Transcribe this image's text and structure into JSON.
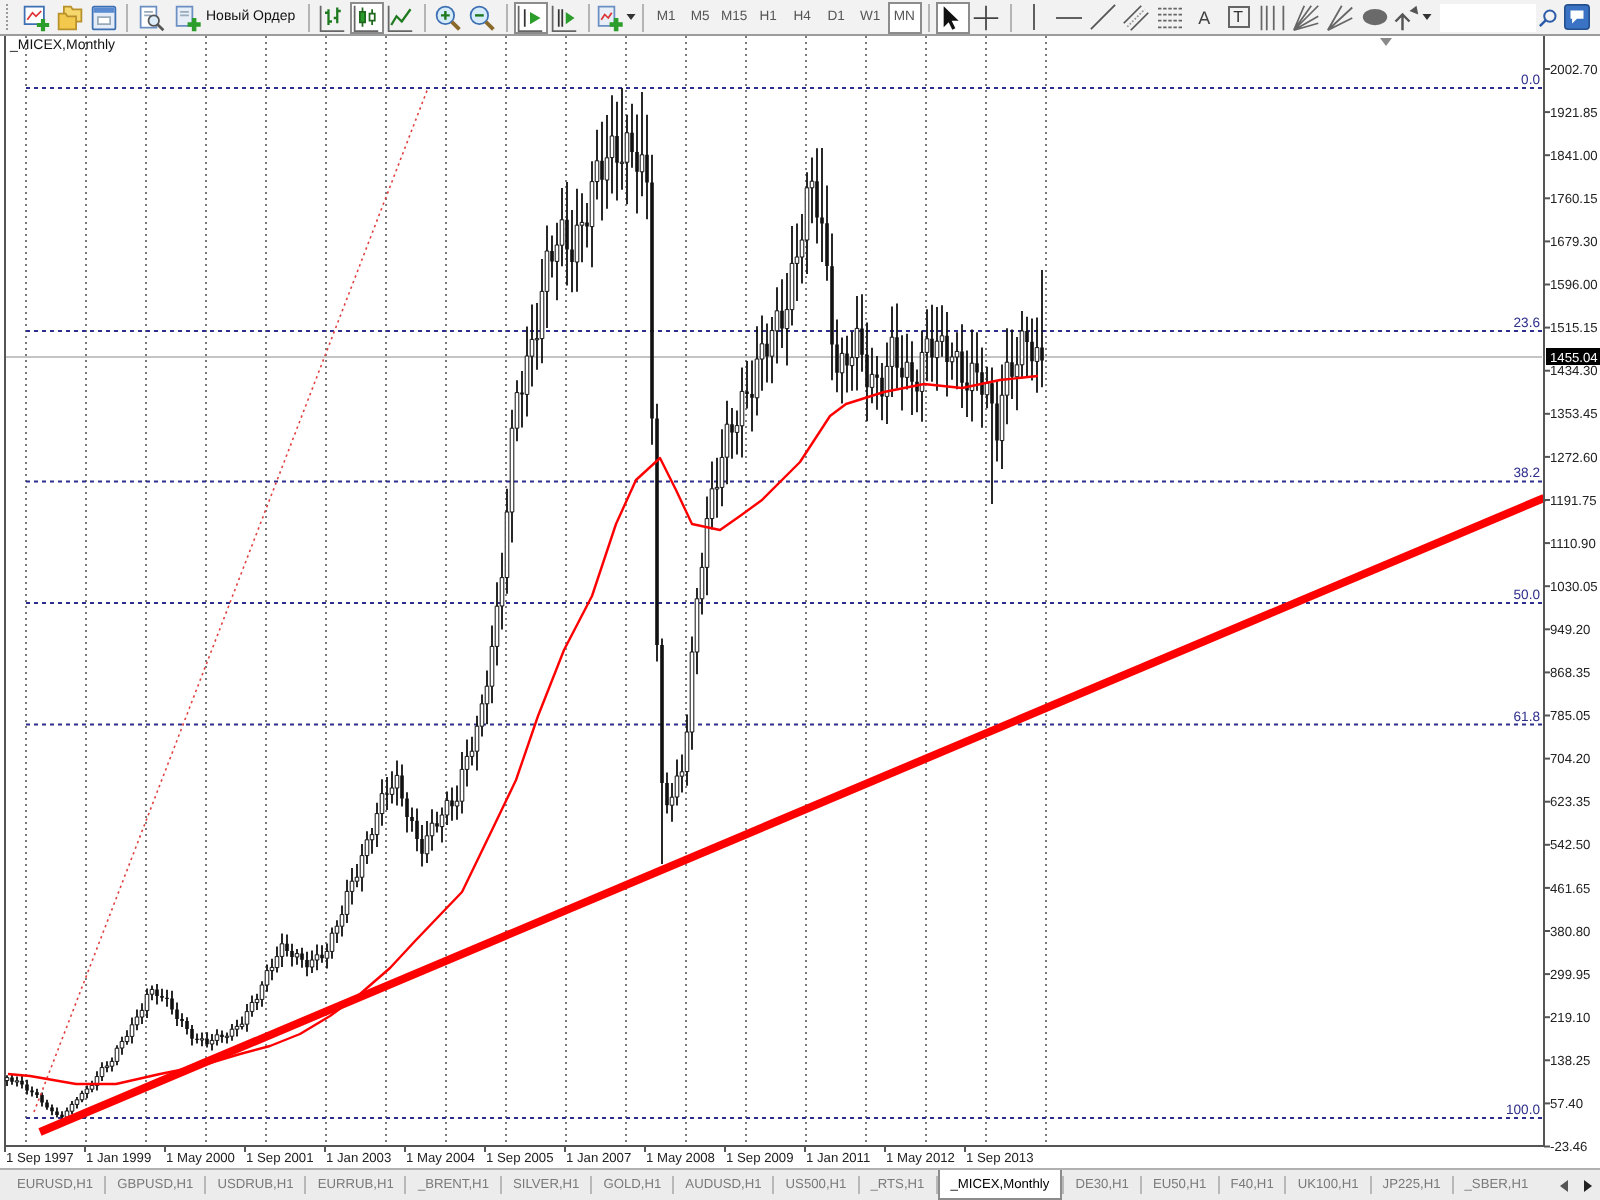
{
  "toolbar": {
    "new_order_button": {
      "label": "Новый Ордер"
    },
    "chart_types": [
      {
        "kind": "bars",
        "selected": false
      },
      {
        "kind": "candles",
        "selected": true
      },
      {
        "kind": "line",
        "selected": false
      }
    ],
    "chart_shift": {
      "on": true
    },
    "auto_scroll": {
      "on": false
    },
    "timeframes": [
      {
        "label": "M1",
        "selected": false
      },
      {
        "label": "M5",
        "selected": false
      },
      {
        "label": "M15",
        "selected": false
      },
      {
        "label": "H1",
        "selected": false
      },
      {
        "label": "H4",
        "selected": false
      },
      {
        "label": "D1",
        "selected": false
      },
      {
        "label": "W1",
        "selected": false
      },
      {
        "label": "MN",
        "selected": true
      }
    ],
    "pointer_tools": [
      {
        "kind": "cursor",
        "selected": true
      },
      {
        "kind": "crosshair",
        "selected": false
      }
    ],
    "drawing_tools": [
      {
        "kind": "vline"
      },
      {
        "kind": "hline"
      },
      {
        "kind": "trend"
      },
      {
        "kind": "channel"
      },
      {
        "kind": "fibo"
      },
      {
        "kind": "text",
        "label": "A"
      },
      {
        "kind": "label",
        "label": "T"
      },
      {
        "kind": "timezones"
      },
      {
        "kind": "gann"
      },
      {
        "kind": "fan"
      },
      {
        "kind": "ellipse"
      },
      {
        "kind": "arrows"
      }
    ]
  },
  "chart": {
    "title": "_MICEX,Monthly",
    "price_labels": [
      "2002.70",
      "1921.85",
      "1841.00",
      "1760.15",
      "1679.30",
      "1596.00",
      "1515.15",
      "1434.30",
      "1353.45",
      "1272.60",
      "1191.75",
      "1110.90",
      "1030.05",
      "949.20",
      "868.35",
      "785.05",
      "704.20",
      "623.35",
      "542.50",
      "461.65",
      "380.80",
      "299.95",
      "219.10",
      "138.25",
      "57.40",
      "-23.46"
    ],
    "current_price": "1455.04",
    "time_labels": [
      "1 Sep 1997",
      "1 Jan 1999",
      "1 May 2000",
      "1 Sep 2001",
      "1 Jan 2003",
      "1 May 2004",
      "1 Sep 2005",
      "1 Jan 2007",
      "1 May 2008",
      "1 Sep 2009",
      "1 Jan 2011",
      "1 May 2012",
      "1 Sep 2013"
    ],
    "fibonacci_levels": [
      "0.0",
      "23.6",
      "38.2",
      "50.0",
      "61.8",
      "100.0"
    ]
  },
  "tabs": [
    {
      "label": "EURUSD,H1",
      "selected": false
    },
    {
      "label": "GBPUSD,H1",
      "selected": false
    },
    {
      "label": "USDRUB,H1",
      "selected": false
    },
    {
      "label": "EURRUB,H1",
      "selected": false
    },
    {
      "label": "_BRENT,H1",
      "selected": false
    },
    {
      "label": "SILVER,H1",
      "selected": false
    },
    {
      "label": "GOLD,H1",
      "selected": false
    },
    {
      "label": "AUDUSD,H1",
      "selected": false
    },
    {
      "label": "US500,H1",
      "selected": false
    },
    {
      "label": "_RTS,H1",
      "selected": false
    },
    {
      "label": "_MICEX,Monthly",
      "selected": true
    },
    {
      "label": "DE30,H1",
      "selected": false
    },
    {
      "label": "EU50,H1",
      "selected": false
    },
    {
      "label": "F40,H1",
      "selected": false
    },
    {
      "label": "UK100,H1",
      "selected": false
    },
    {
      "label": "JP225,H1",
      "selected": false
    },
    {
      "label": "_SBER,H1",
      "selected": false
    }
  ]
}
